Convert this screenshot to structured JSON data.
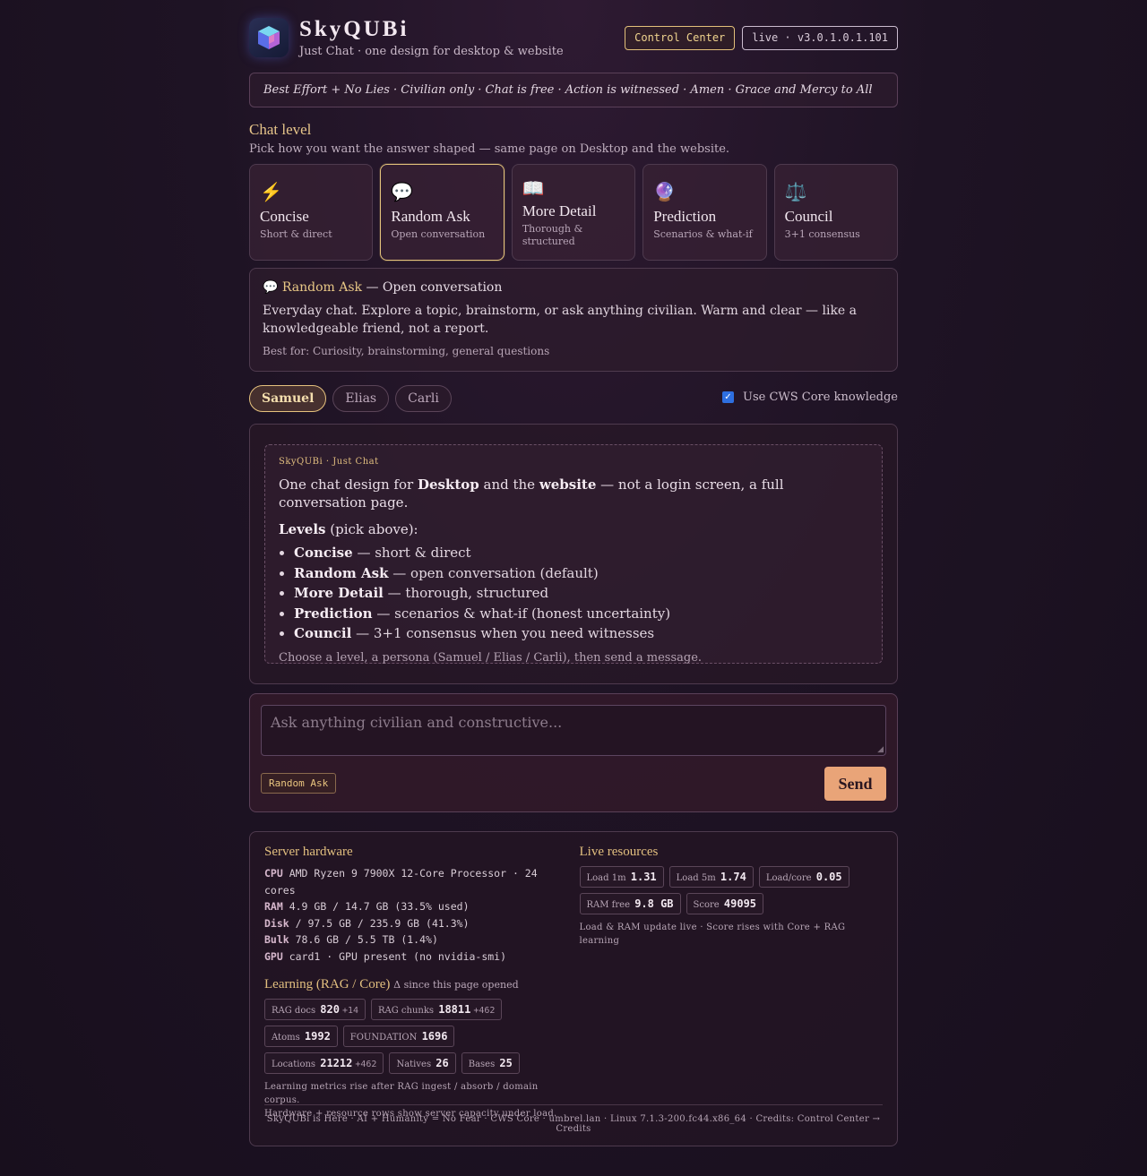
{
  "header": {
    "title": "SkyQUBi",
    "subtitle": "Just Chat · one design for desktop & website",
    "control_center": "Control Center",
    "version": "live · v3.0.1.0.1.101"
  },
  "motto": "Best Effort + No Lies · Civilian only · Chat is free · Action is witnessed · Amen · Grace and Mercy to All",
  "chat_level": {
    "title": "Chat level",
    "subtitle": "Pick how you want the answer shaped — same page on Desktop and the website.",
    "levels": [
      {
        "icon": "⚡",
        "name": "Concise",
        "desc": "Short & direct"
      },
      {
        "icon": "💬",
        "name": "Random Ask",
        "desc": "Open conversation"
      },
      {
        "icon": "📖",
        "name": "More Detail",
        "desc": "Thorough & structured"
      },
      {
        "icon": "🔮",
        "name": "Prediction",
        "desc": "Scenarios & what-if"
      },
      {
        "icon": "⚖️",
        "name": "Council",
        "desc": "3+1 consensus"
      }
    ],
    "selected_index": 1
  },
  "info": {
    "icon": "💬",
    "name": "Random Ask",
    "tagline": "— Open conversation",
    "body": "Everyday chat. Explore a topic, brainstorm, or ask anything civilian. Warm and clear — like a knowledgeable friend, not a report.",
    "best_for": "Best for: Curiosity, brainstorming, general questions"
  },
  "personas": [
    "Samuel",
    "Elias",
    "Carli"
  ],
  "selected_persona": "Samuel",
  "cws_label": "Use CWS Core knowledge",
  "cws_checked": true,
  "message": {
    "tag": "SkyQUBi · Just Chat",
    "intro_a": "One chat design for ",
    "intro_b": "Desktop",
    "intro_c": " and the ",
    "intro_d": "website",
    "intro_e": " — not a login screen, a full conversation page.",
    "levels_label": "Levels",
    "levels_hint": " (pick above):",
    "items": [
      {
        "name": "Concise",
        "text": " — short & direct"
      },
      {
        "name": "Random Ask",
        "text": " — open conversation (default)"
      },
      {
        "name": "More Detail",
        "text": " — thorough, structured"
      },
      {
        "name": "Prediction",
        "text": " — scenarios & what-if (honest uncertainty)"
      },
      {
        "name": "Council",
        "text": " — 3+1 consensus when you need witnesses"
      }
    ],
    "footer": "Choose a level, a persona (Samuel / Elias / Carli), then send a message."
  },
  "compose": {
    "placeholder": "Ask anything civilian and constructive...",
    "mode": "Random Ask",
    "send": "Send"
  },
  "server": {
    "title": "Server hardware",
    "rows": [
      {
        "k": "CPU",
        "v": " AMD Ryzen 9 7900X 12-Core Processor · 24 cores"
      },
      {
        "k": "RAM",
        "v": " 4.9 GB / 14.7 GB (33.5% used)"
      },
      {
        "k": "Disk",
        "v": " / 97.5 GB / 235.9 GB (41.3%)"
      },
      {
        "k": "Bulk",
        "v": " 78.6 GB / 5.5 TB (1.4%)"
      },
      {
        "k": "GPU",
        "v": " card1 · GPU present (no nvidia-smi)"
      }
    ]
  },
  "learning": {
    "title": "Learning (RAG / Core)",
    "note_inline": "Δ since this page opened",
    "badges": [
      {
        "label": "RAG docs",
        "value": "820",
        "delta": "+14"
      },
      {
        "label": "RAG chunks",
        "value": "18811",
        "delta": "+462"
      },
      {
        "label": "Atoms",
        "value": "1992",
        "delta": ""
      },
      {
        "label": "FOUNDATION",
        "value": "1696",
        "delta": ""
      },
      {
        "label": "Locations",
        "value": "21212",
        "delta": "+462"
      },
      {
        "label": "Natives",
        "value": "26",
        "delta": ""
      },
      {
        "label": "Bases",
        "value": "25",
        "delta": ""
      }
    ],
    "note_1": "Learning metrics rise after RAG ingest / absorb / domain corpus.",
    "note_2": "Hardware + resource rows show server capacity under load."
  },
  "live": {
    "title": "Live resources",
    "badges": [
      {
        "label": "Load 1m",
        "value": "1.31"
      },
      {
        "label": "Load 5m",
        "value": "1.74"
      },
      {
        "label": "Load/core",
        "value": "0.05"
      },
      {
        "label": "RAM free",
        "value": "9.8 GB"
      },
      {
        "label": "Score",
        "value": "49095"
      }
    ],
    "note": "Load & RAM update live · Score rises with Core + RAG learning"
  },
  "footer": "SkyQUBi is Here · AI + Humanity = No Fear · CWS Core · umbrel.lan · Linux 7.1.3-200.fc44.x86_64 · Credits: Control Center → Credits"
}
